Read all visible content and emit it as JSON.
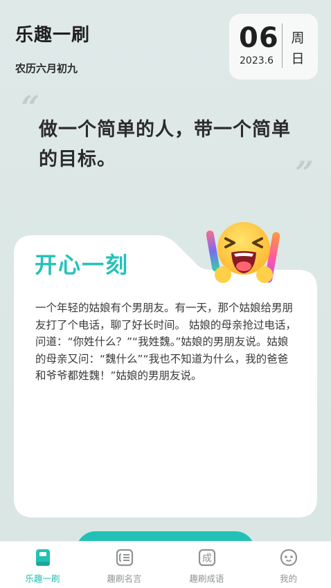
{
  "header": {
    "app_title": "乐趣一刷",
    "lunar_date": "农历六月初九"
  },
  "date_card": {
    "day": "06",
    "year_month": "2023.6",
    "weekday_top": "周",
    "weekday_bottom": "日"
  },
  "quote": {
    "open_mark": "“",
    "close_mark": "”",
    "text": "做一个简单的人，带一个简单的目标。"
  },
  "joke_card": {
    "title": "开心一刻",
    "text": "一个年轻的姑娘有个男朋友。有一天，那个姑娘给男朋友打了个电话，聊了好长时间。 姑娘的母亲抢过电话，问道：“你姓什么？”“我姓魏。”姑娘的男朋友说。姑娘的母亲又问：“魏什么”“我也不知道为什么，我的爸爸和爷爷都姓魏！”姑娘的男朋友说。"
  },
  "tabbar": {
    "tabs": [
      {
        "label": "乐趣一刷",
        "icon": "book-icon",
        "active": true
      },
      {
        "label": "趣刷名言",
        "icon": "quote-list-icon",
        "active": false
      },
      {
        "label": "趣刷成语",
        "icon": "idiom-icon",
        "active": false
      },
      {
        "label": "我的",
        "icon": "profile-face-icon",
        "active": false
      }
    ],
    "idiom_icon_char": "成"
  },
  "colors": {
    "accent": "#23c1b5",
    "background": "#dde8e6",
    "card": "#ffffff"
  }
}
